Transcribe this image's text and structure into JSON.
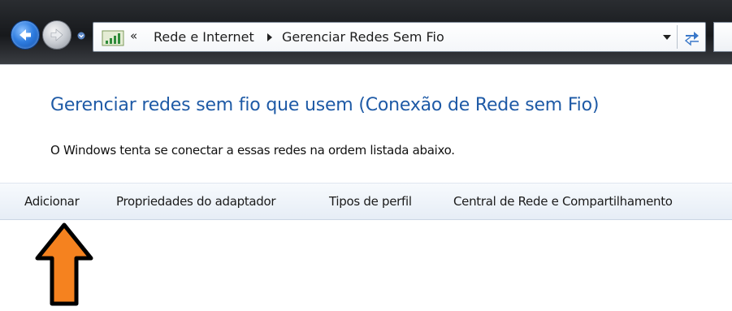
{
  "address_bar": {
    "overflow_glyph": "«",
    "crumbs": [
      "Rede e Internet",
      "Gerenciar Redes Sem Fio"
    ]
  },
  "main": {
    "heading": "Gerenciar redes sem fio que usem (Conexão de Rede sem Fio)",
    "description": "O Windows tenta se conectar a essas redes na ordem listada abaixo."
  },
  "command_bar": {
    "items": [
      "Adicionar",
      "Propriedades do adaptador",
      "Tipos de perfil",
      "Central de Rede e Compartilhamento"
    ]
  },
  "annotation": {
    "arrow_color": "#f5821f",
    "target": "Adicionar"
  },
  "colors": {
    "heading": "#1e5aa6",
    "titlebar": "#1c1e22",
    "command_bar": "#e9eff7"
  },
  "icons": [
    "back-arrow-icon",
    "forward-arrow-icon",
    "network-icon",
    "breadcrumb-arrow-icon",
    "dropdown-icon",
    "refresh-icon",
    "orange-arrow-icon"
  ]
}
